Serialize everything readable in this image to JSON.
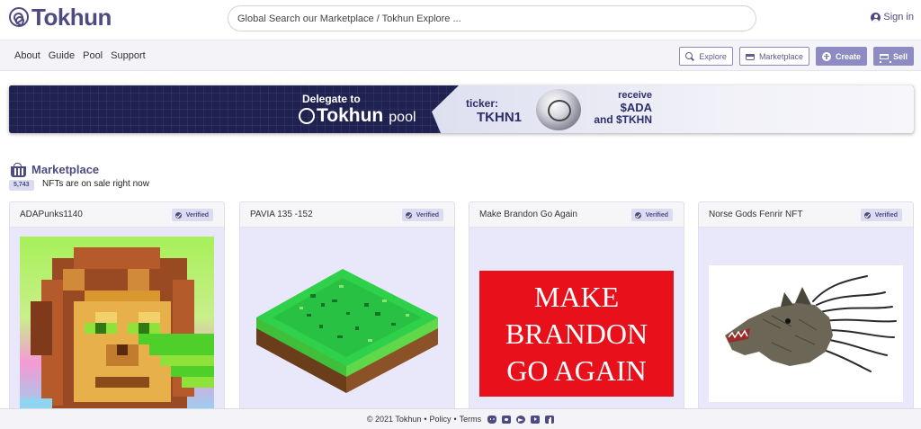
{
  "header": {
    "brand": "Tokhun",
    "search_placeholder": "Global Search our Marketplace / Tokhun Explore ...",
    "signin_label": "Sign in"
  },
  "nav": {
    "links": [
      "About",
      "Guide",
      "Pool",
      "Support"
    ],
    "buttons": {
      "explore": "Explore",
      "marketplace": "Marketplace",
      "create": "Create",
      "sell": "Sell"
    }
  },
  "banner": {
    "delegate_line": "Delegate to",
    "brand": "Tokhun",
    "pool_word": "pool",
    "ticker_label": "ticker:",
    "ticker_value": "TKHN1",
    "receive_label": "receive",
    "reward_1": "$ADA",
    "reward_2": "and $TKHN"
  },
  "marketplace": {
    "title": "Marketplace",
    "count_badge": "5,743",
    "count_text": "NFTs are on sale right now",
    "cards": [
      {
        "title": "ADAPunks1140",
        "badge": "Verified",
        "image": "pixel-lion-art"
      },
      {
        "title": "PAVIA 135 -152",
        "badge": "Verified",
        "image": "isometric-land-tile"
      },
      {
        "title": "Make Brandon Go Again",
        "badge": "Verified",
        "image": "red-sign",
        "image_text": [
          "MAKE",
          "BRANDON",
          "GO AGAIN"
        ]
      },
      {
        "title": "Norse Gods Fenrir NFT",
        "badge": "Verified",
        "image": "wolf-illustration"
      }
    ]
  },
  "footer": {
    "copyright": "© 2021 Tokhun",
    "policy": "Policy",
    "terms": "Terms",
    "social_icons": [
      "discord-icon",
      "twitter-icon",
      "telegram-icon",
      "youtube-icon",
      "facebook-icon"
    ]
  },
  "colors": {
    "brand": "#4d4b82",
    "button_fill": "#8e8bc2",
    "card_body": "#e9e8fa",
    "sign_red": "#e8101a"
  }
}
